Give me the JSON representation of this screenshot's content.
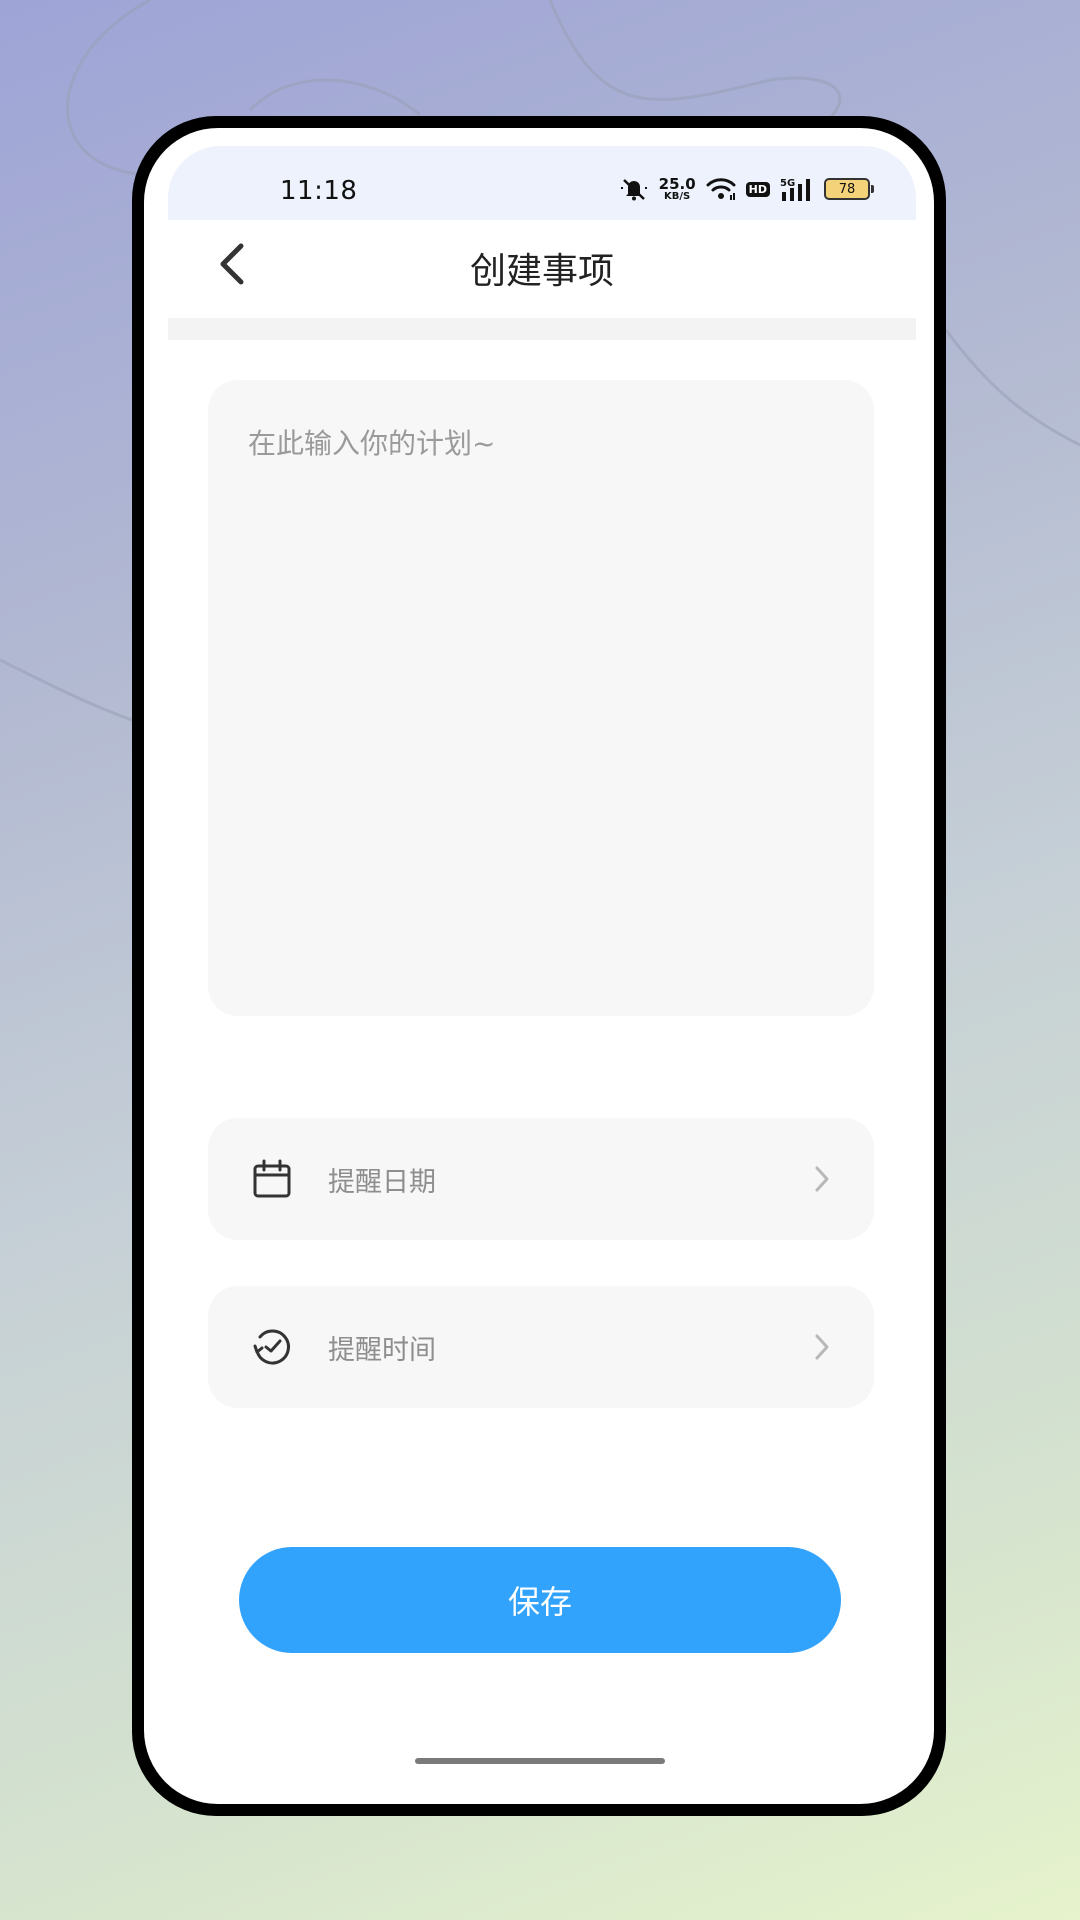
{
  "status_bar": {
    "time": "11:18",
    "net_speed_value": "25.0",
    "net_speed_unit": "KB/S",
    "hd_label": "HD",
    "network_label": "5G",
    "battery_level": "78",
    "icons": [
      "mute-icon",
      "wifi-icon",
      "hd-icon",
      "signal-icon",
      "battery-icon"
    ]
  },
  "header": {
    "title": "创建事项",
    "back_icon": "chevron-left-icon"
  },
  "plan_input": {
    "value": "",
    "placeholder": "在此输入你的计划~"
  },
  "reminder_date": {
    "label": "提醒日期",
    "icon": "calendar-icon"
  },
  "reminder_time": {
    "label": "提醒时间",
    "icon": "clock-icon"
  },
  "save_button": {
    "label": "保存"
  },
  "colors": {
    "accent": "#31a3fc",
    "field_bg": "#f7f7f7",
    "status_bar_bg": "#eef2fd",
    "battery_fill": "#f3d27a"
  }
}
